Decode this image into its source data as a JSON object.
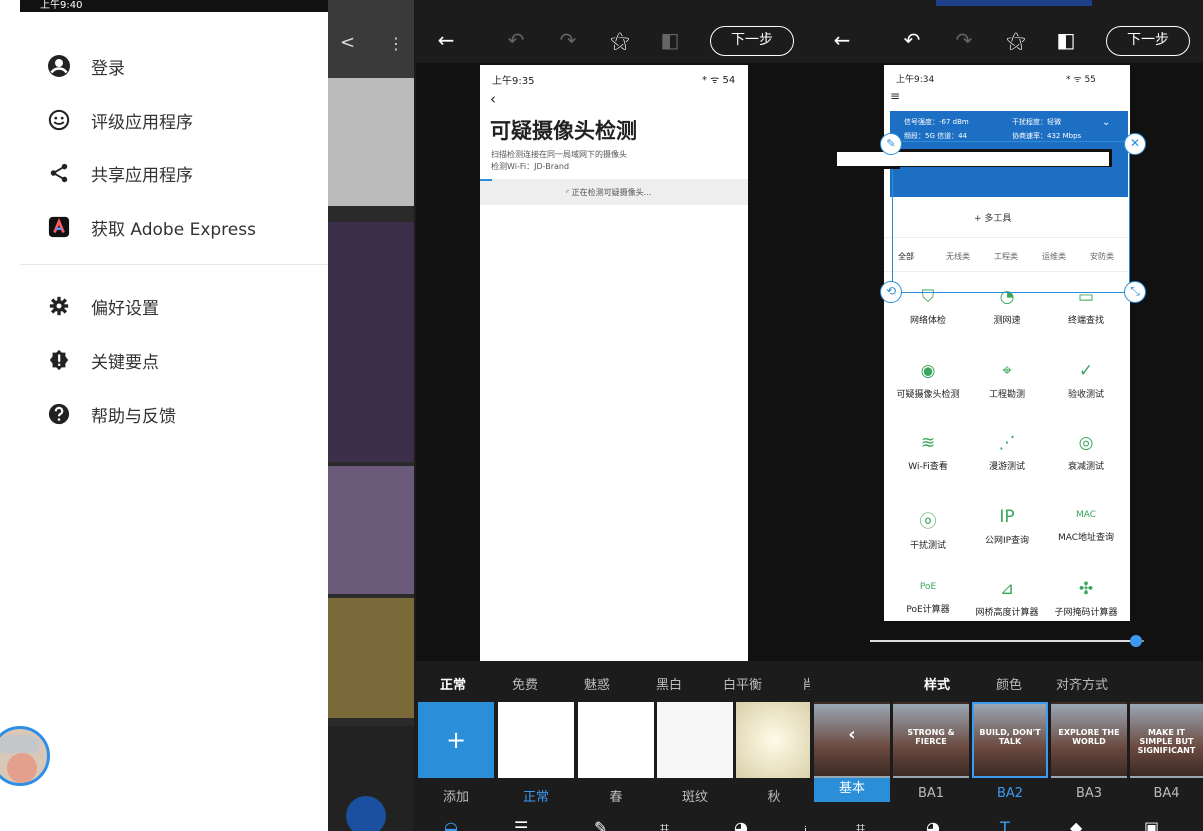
{
  "drawer": {
    "status_time": "上午9:40",
    "items": [
      {
        "label": "登录",
        "icon": "account-icon"
      },
      {
        "label": "评级应用程序",
        "icon": "smiley-icon"
      },
      {
        "label": "共享应用程序",
        "icon": "share-icon"
      },
      {
        "label": "获取 Adobe Express",
        "icon": "adobe-express-icon"
      },
      {
        "label": "偏好设置",
        "icon": "gear-icon"
      },
      {
        "label": "关键要点",
        "icon": "alert-badge-icon"
      },
      {
        "label": "帮助与反馈",
        "icon": "help-icon"
      }
    ]
  },
  "editor1": {
    "next_label": "下一步",
    "phone": {
      "time": "上午9:35",
      "status_right": "* ᯤ 54",
      "title": "可疑摄像头检测",
      "desc": "扫描检测连接在同一局域网下的摄像头",
      "wifi": "检测Wi-Fi：JD-Brand",
      "detecting": "正在检测可疑摄像头..."
    },
    "filter_tabs": [
      "正常",
      "免费",
      "魅惑",
      "黑白",
      "白平衡",
      "肖"
    ],
    "thumbs": [
      {
        "label": "添加"
      },
      {
        "label": "正常"
      },
      {
        "label": "春"
      },
      {
        "label": "斑纹"
      },
      {
        "label": "秋"
      }
    ],
    "add_symbol": "+"
  },
  "editor2": {
    "next_label": "下一步",
    "phone": {
      "time": "上午9:34",
      "status_right": "* ᯤ 55",
      "signal": "信号强度：-67 dBm",
      "interference": "干扰程度：轻微",
      "band": "频段：5G  信道：44",
      "rate": "协商速率：432 Mbps",
      "tool_line": "+ 多工具",
      "tabs": [
        "全部",
        "无线类",
        "工程类",
        "运维类",
        "安防类"
      ],
      "grid": [
        {
          "label": "网络体检",
          "icon": "shield-check-icon",
          "glyph": "⛉"
        },
        {
          "label": "测网速",
          "icon": "speed-gauge-icon",
          "glyph": "◔"
        },
        {
          "label": "终端查找",
          "icon": "devices-icon",
          "glyph": "▭"
        },
        {
          "label": "可疑摄像头检测",
          "icon": "camera-icon",
          "glyph": "◉"
        },
        {
          "label": "工程勘测",
          "icon": "location-icon",
          "glyph": "⌖"
        },
        {
          "label": "验收测试",
          "icon": "check-circle-icon",
          "glyph": "✓"
        },
        {
          "label": "Wi-Fi查看",
          "icon": "wifi-icon",
          "glyph": "≋"
        },
        {
          "label": "漫游测试",
          "icon": "roam-icon",
          "glyph": "⋰"
        },
        {
          "label": "衰减测试",
          "icon": "attenuation-icon",
          "glyph": "◎"
        },
        {
          "label": "干扰测试",
          "icon": "interference-icon",
          "glyph": "ⓞ"
        },
        {
          "label": "公网IP查询",
          "icon": "ip-icon",
          "glyph": "IP"
        },
        {
          "label": "MAC地址查询",
          "icon": "mac-icon",
          "glyph": "MAC"
        },
        {
          "label": "PoE计算器",
          "icon": "poe-icon",
          "glyph": "PoE"
        },
        {
          "label": "网桥高度计算器",
          "icon": "bridge-height-icon",
          "glyph": "⊿"
        },
        {
          "label": "子网掩码计算器",
          "icon": "subnet-icon",
          "glyph": "✣"
        }
      ]
    },
    "style_tabs": [
      "样式",
      "颜色",
      "对齐方式"
    ],
    "style_thumbs": [
      {
        "label": "基本",
        "text": ""
      },
      {
        "label": "BA1",
        "text": "STRONG & FIERCE"
      },
      {
        "label": "BA2",
        "text": "BUILD, DON'T TALK"
      },
      {
        "label": "BA3",
        "text": "EXPLORE THE WORLD"
      },
      {
        "label": "BA4",
        "text": "MAKE IT SIMPLE BUT SIGNIFICANT"
      }
    ],
    "slider_value": 0.97
  },
  "colors": {
    "accent": "#2a8fd8",
    "selected": "#3b9bf0"
  }
}
